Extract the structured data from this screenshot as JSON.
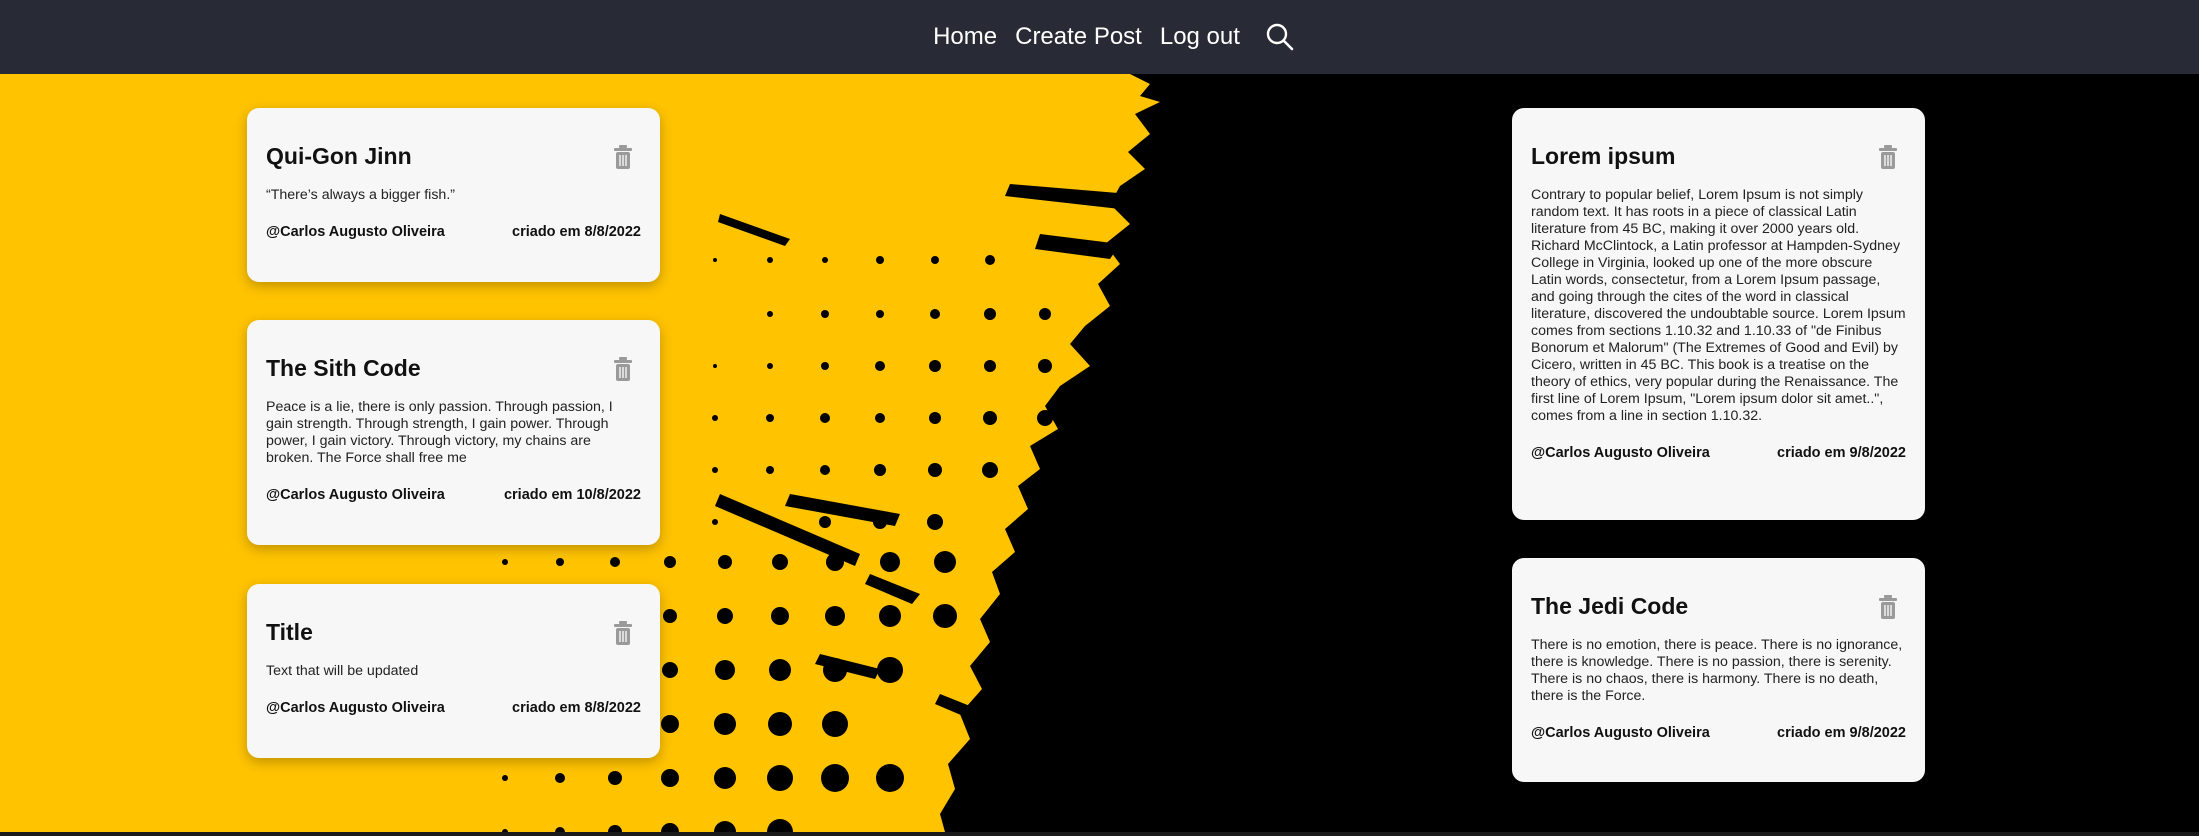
{
  "nav": {
    "home": "Home",
    "create_post": "Create Post",
    "logout": "Log out",
    "search_icon": "search-icon"
  },
  "colors": {
    "nav_bg": "#282a35",
    "accent_yellow": "#ffc300",
    "card_bg": "#f7f7f7",
    "dark_bg": "#000000"
  },
  "posts": [
    {
      "title": "Qui-Gon Jinn",
      "text": "“There’s always a bigger fish.”",
      "author": "@Carlos Augusto Oliveira",
      "date": "criado em 8/8/2022"
    },
    {
      "title": "The Sith Code",
      "text": "Peace is a lie, there is only passion. Through passion, I gain strength. Through strength, I gain power. Through power, I gain victory. Through victory, my chains are broken. The Force shall free me",
      "author": "@Carlos Augusto Oliveira",
      "date": "criado em 10/8/2022"
    },
    {
      "title": "Title",
      "text": "Text that will be updated",
      "author": "@Carlos Augusto Oliveira",
      "date": "criado em 8/8/2022"
    },
    {
      "title": "Lorem ipsum",
      "text": "Contrary to popular belief, Lorem Ipsum is not simply random text. It has roots in a piece of classical Latin literature from 45 BC, making it over 2000 years old. Richard McClintock, a Latin professor at Hampden-Sydney College in Virginia, looked up one of the more obscure Latin words, consectetur, from a Lorem Ipsum passage, and going through the cites of the word in classical literature, discovered the undoubtable source. Lorem Ipsum comes from sections 1.10.32 and 1.10.33 of \"de Finibus Bonorum et Malorum\" (The Extremes of Good and Evil) by Cicero, written in 45 BC. This book is a treatise on the theory of ethics, very popular during the Renaissance. The first line of Lorem Ipsum, \"Lorem ipsum dolor sit amet..\", comes from a line in section 1.10.32.",
      "author": "@Carlos Augusto Oliveira",
      "date": "criado em 9/8/2022"
    },
    {
      "title": "The Jedi Code",
      "text": "There is no emotion, there is peace. There is no ignorance, there is knowledge. There is no passion, there is serenity. There is no chaos, there is harmony. There is no death, there is the Force.",
      "author": "@Carlos Augusto Oliveira",
      "date": "criado em 9/8/2022"
    }
  ]
}
